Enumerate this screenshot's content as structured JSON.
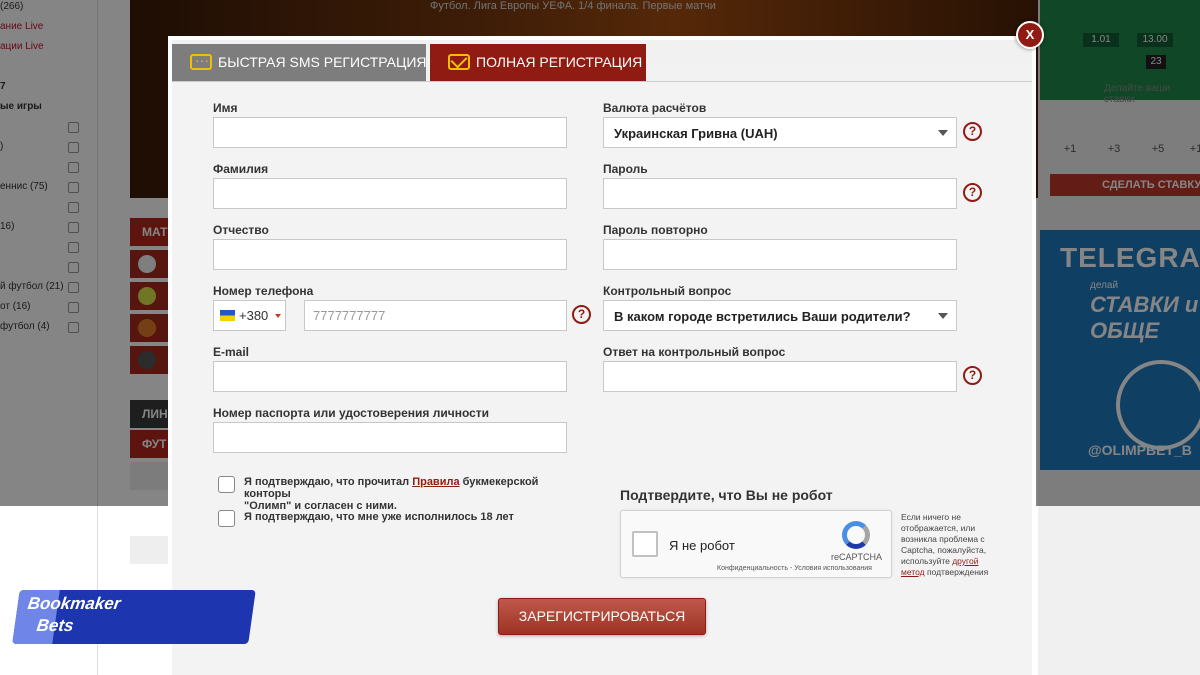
{
  "background": {
    "sidebar": [
      {
        "text": "(266)",
        "style": "",
        "check": false
      },
      {
        "text": "ание Live",
        "style": "live",
        "check": false
      },
      {
        "text": "ации Live",
        "style": "live",
        "check": false
      },
      {
        "text": "",
        "style": "",
        "check": false
      },
      {
        "text": "7",
        "style": "bold",
        "check": false
      },
      {
        "text": "ые игры",
        "style": "bold",
        "check": false
      },
      {
        "text": "",
        "style": "",
        "check": true
      },
      {
        "text": ")",
        "style": "",
        "check": true
      },
      {
        "text": "",
        "style": "",
        "check": true
      },
      {
        "text": "еннис (75)",
        "style": "",
        "check": true
      },
      {
        "text": "",
        "style": "",
        "check": true
      },
      {
        "text": "16)",
        "style": "",
        "check": true
      },
      {
        "text": "",
        "style": "",
        "check": true
      },
      {
        "text": "",
        "style": "",
        "check": true
      },
      {
        "text": "й футбол (21)",
        "style": "",
        "check": true
      },
      {
        "text": "от (16)",
        "style": "",
        "check": true
      },
      {
        "text": "футбол (4)",
        "style": "",
        "check": true
      }
    ],
    "video_caption": "Футбол. Лига Европы УЕФА. 1/4 финала. Первые матчи",
    "cat_matches": "МАТ",
    "cat_lines": "ЛИН",
    "cat_football": "ФУТ",
    "odds": [
      "1.01",
      "13.00"
    ],
    "odd_count": "23",
    "bet_note": "Делайте ваши ставки",
    "increments": [
      "+1",
      "+3",
      "+5",
      "+1"
    ],
    "make_bet": "СДЕЛАТЬ СТАВКУ",
    "telegram": {
      "title": "TELEGRAM",
      "line1": "делай",
      "line2": "СТАВКИ и прог",
      "line3": "ОБЩЕ",
      "handle": "@OLIMPBET_B"
    }
  },
  "modal": {
    "close_label": "X",
    "tabs": [
      {
        "label": "БЫСТРАЯ SMS РЕГИСТРАЦИЯ",
        "active": false
      },
      {
        "label": "ПОЛНАЯ РЕГИСТРАЦИЯ",
        "active": true
      }
    ],
    "fields": {
      "first_name": {
        "label": "Имя",
        "value": ""
      },
      "last_name": {
        "label": "Фамилия",
        "value": ""
      },
      "patronymic": {
        "label": "Отчество",
        "value": ""
      },
      "phone": {
        "label": "Номер телефона",
        "code": "+380",
        "placeholder": "7777777777",
        "value": ""
      },
      "email": {
        "label": "E-mail",
        "value": ""
      },
      "passport": {
        "label": "Номер паспорта или удостоверения личности",
        "value": ""
      },
      "currency": {
        "label": "Валюта расчётов",
        "value": "Украинская Гривна (UAH)"
      },
      "password": {
        "label": "Пароль",
        "value": ""
      },
      "password_repeat": {
        "label": "Пароль повторно",
        "value": ""
      },
      "security_question": {
        "label": "Контрольный вопрос",
        "value": "В каком городе встретились Ваши родители?"
      },
      "security_answer": {
        "label": "Ответ на контрольный вопрос",
        "value": ""
      }
    },
    "help_symbol": "?",
    "agree_rules": {
      "before": "Я подтверждаю, что прочитал ",
      "link": "Правила",
      "after": " букмекерской конторы",
      "line2": "\"Олимп\" и согласен с ними."
    },
    "agree_age": "Я подтверждаю, что мне уже исполнилось 18 лет",
    "captcha": {
      "title": "Подтвердите, что Вы не робот",
      "not_robot": "Я не робот",
      "brand": "reCAPTCHA",
      "privacy": "Конфиденциальность - Условия использования",
      "note_before": "Если ничего не отображается, или возникла проблема с Captcha, пожалуйста, используйте ",
      "note_link": "другой метод",
      "note_after": " подтверждения"
    },
    "submit_label": "ЗАРЕГИСТРИРОВАТЬСЯ"
  },
  "watermark": {
    "line1": "Bookmaker",
    "line2": "Bets"
  }
}
